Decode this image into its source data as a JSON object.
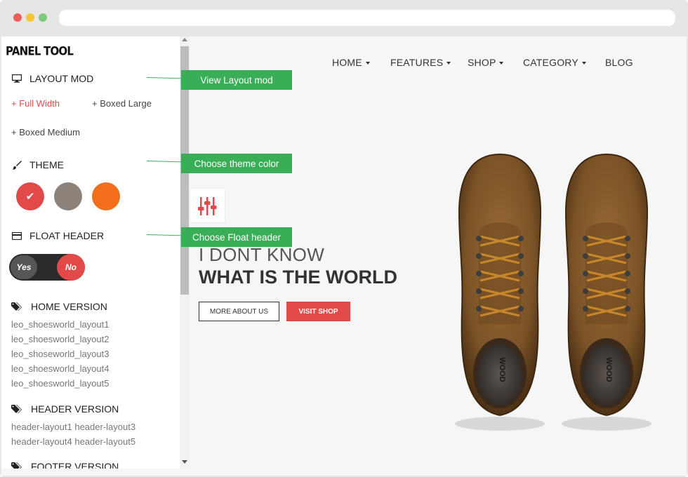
{
  "panel": {
    "title": "PANEL TOOL",
    "layout": {
      "heading": "LAYOUT MOD",
      "options": [
        "+ Full Width",
        "+ Boxed Large",
        "+ Boxed Medium"
      ],
      "active_option": "+ Full Width"
    },
    "theme": {
      "heading": "THEME",
      "swatches": [
        "#e24a4a",
        "#8c8279",
        "#f26d1c"
      ],
      "selected": "#e24a4a"
    },
    "float_header": {
      "heading": "FLOAT HEADER",
      "yes_label": "Yes",
      "no_label": "No",
      "value": "No"
    },
    "home_version": {
      "heading": "HOME VERSION",
      "items": [
        "leo_shoesworld_layout1",
        "leo_shoesworld_layout2",
        "leo_shoseworld_layout3",
        "leo_shoesworld_layout4",
        "leo_shoesworld_layout5"
      ]
    },
    "header_version": {
      "heading": "HEADER VERSION",
      "lines": [
        "header-layout1 header-layout3",
        "header-layout4 header-layout5"
      ]
    },
    "footer_version": {
      "heading": "FOOTER VERSION"
    }
  },
  "callouts": {
    "layout": "View Layout mod",
    "theme": "Choose theme color",
    "float": "Choose Float header"
  },
  "nav": {
    "items": [
      {
        "label": "HOME",
        "dropdown": true
      },
      {
        "label": "FEATURES",
        "dropdown": true
      },
      {
        "label": "SHOP",
        "dropdown": true
      },
      {
        "label": "CATEGORY",
        "dropdown": true
      },
      {
        "label": "BLOG",
        "dropdown": false
      }
    ]
  },
  "hero": {
    "line1": "I DONT KNOW",
    "line2": "WHAT IS THE WORLD",
    "btn_more": "MORE ABOUT US",
    "btn_shop": "VISIT SHOP",
    "boot_text": "WOOD"
  },
  "colors": {
    "accent": "#e24a4a",
    "callout": "#3aad57"
  }
}
